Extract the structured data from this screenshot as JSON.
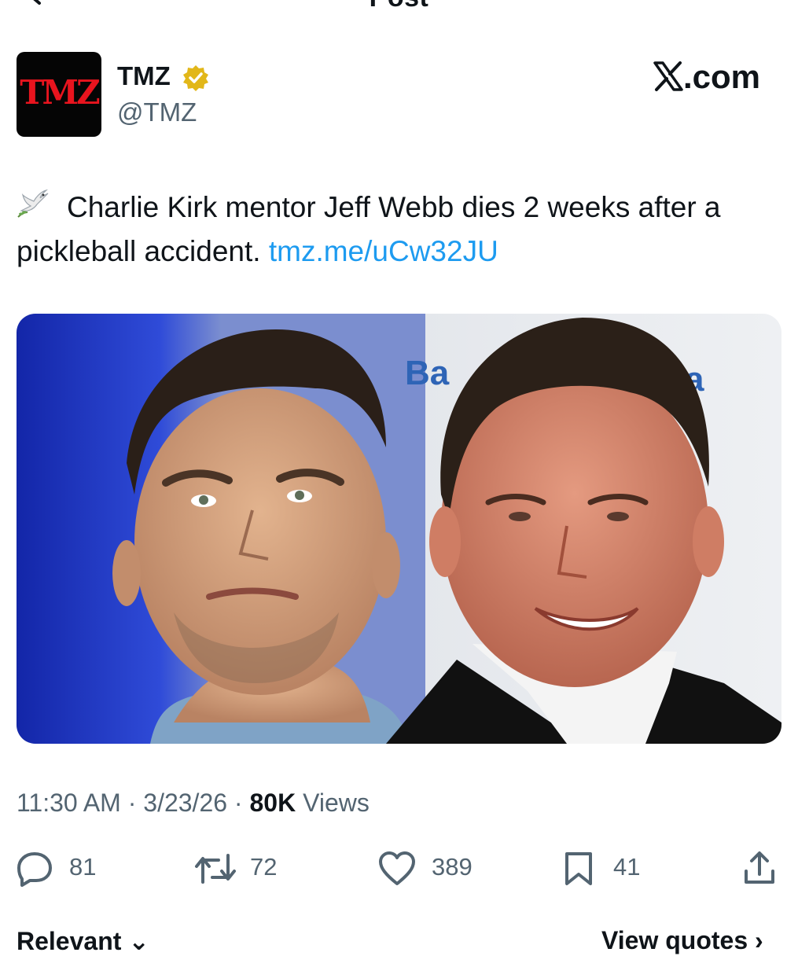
{
  "nav": {
    "title": "Post"
  },
  "author": {
    "avatar_text": "TMZ",
    "name": "TMZ",
    "handle": "@TMZ"
  },
  "site_label": ".com",
  "tweet": {
    "text": "Charlie Kirk mentor Jeff Webb dies 2 weeks after a pickleball accident.",
    "link": "tmz.me/uCw32JU"
  },
  "media": {
    "background_sign_left": "Ba",
    "background_sign_right": "a"
  },
  "meta": {
    "time": "11:30 AM",
    "date": "3/23/26",
    "views_count": "80K",
    "views_label": "Views",
    "separator": "·"
  },
  "actions": {
    "replies": "81",
    "reposts": "72",
    "likes": "389",
    "bookmarks": "41"
  },
  "tabs": {
    "relevant": "Relevant",
    "view_quotes": "View quotes"
  },
  "colors": {
    "link": "#1d9bf0",
    "muted": "#536471",
    "verified": "#e2b719",
    "tmz_red": "#e8141e"
  }
}
